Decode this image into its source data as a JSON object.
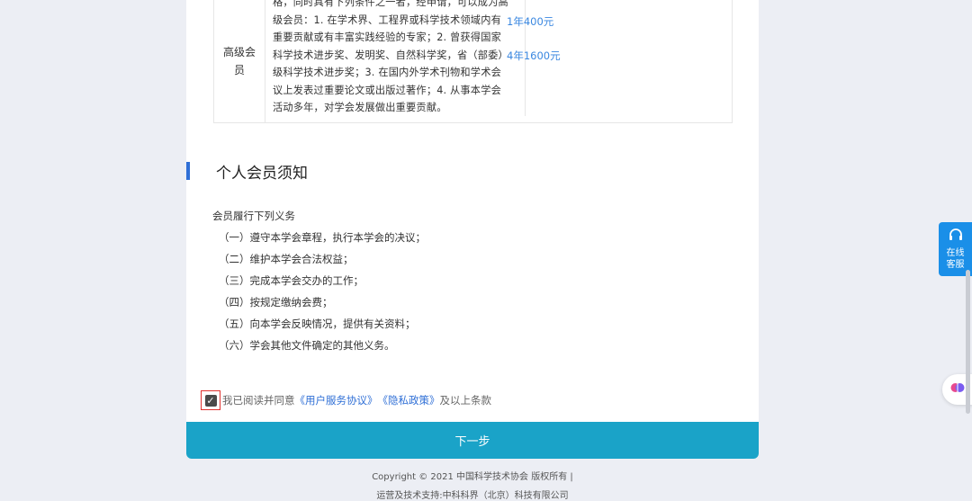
{
  "table": {
    "level": "高级会员",
    "conditions": "格，同时具有下列条件之一者，经申请，可以成为高\n级会员：1. 在学术界、工程界或科学技术领域内有\n重要贡献或有丰富实践经验的专家；2. 曾获得国家\n科学技术进步奖、发明奖、自然科学奖，省（部委）\n级科学技术进步奖；3. 在国内外学术刊物和学术会\n议上发表过重要论文或出版过著作；4. 从事本学会\n活动多年，对学会发展做出重要贡献。",
    "fees": [
      "1年400元",
      "4年1600元"
    ]
  },
  "section": {
    "title": "个人会员须知",
    "lead": "会员履行下列义务",
    "duties": [
      "（一）遵守本学会章程，执行本学会的决议；",
      "（二）维护本学会合法权益；",
      "（三）完成本学会交办的工作；",
      "（四）按规定缴纳会费；",
      "（五）向本学会反映情况，提供有关资料；",
      "（六）学会其他文件确定的其他义务。"
    ]
  },
  "agreement": {
    "checked": true,
    "prefix": "我已阅读并同意",
    "link1": "《用户服务协议》",
    "link2": "《隐私政策》",
    "suffix": "及以上条款"
  },
  "next_button": "下一步",
  "footer": {
    "copyright": "Copyright © 2021 中国科学技术协会 版权所有 |",
    "support": "运营及技术支持:中科科界（北京）科技有限公司"
  },
  "service": {
    "label_line1": "在线",
    "label_line2": "客服"
  },
  "colors": {
    "accent": "#2f6fd6",
    "button": "#1aa3c8",
    "service": "#1a8fe8",
    "highlight": "#e0322f"
  }
}
